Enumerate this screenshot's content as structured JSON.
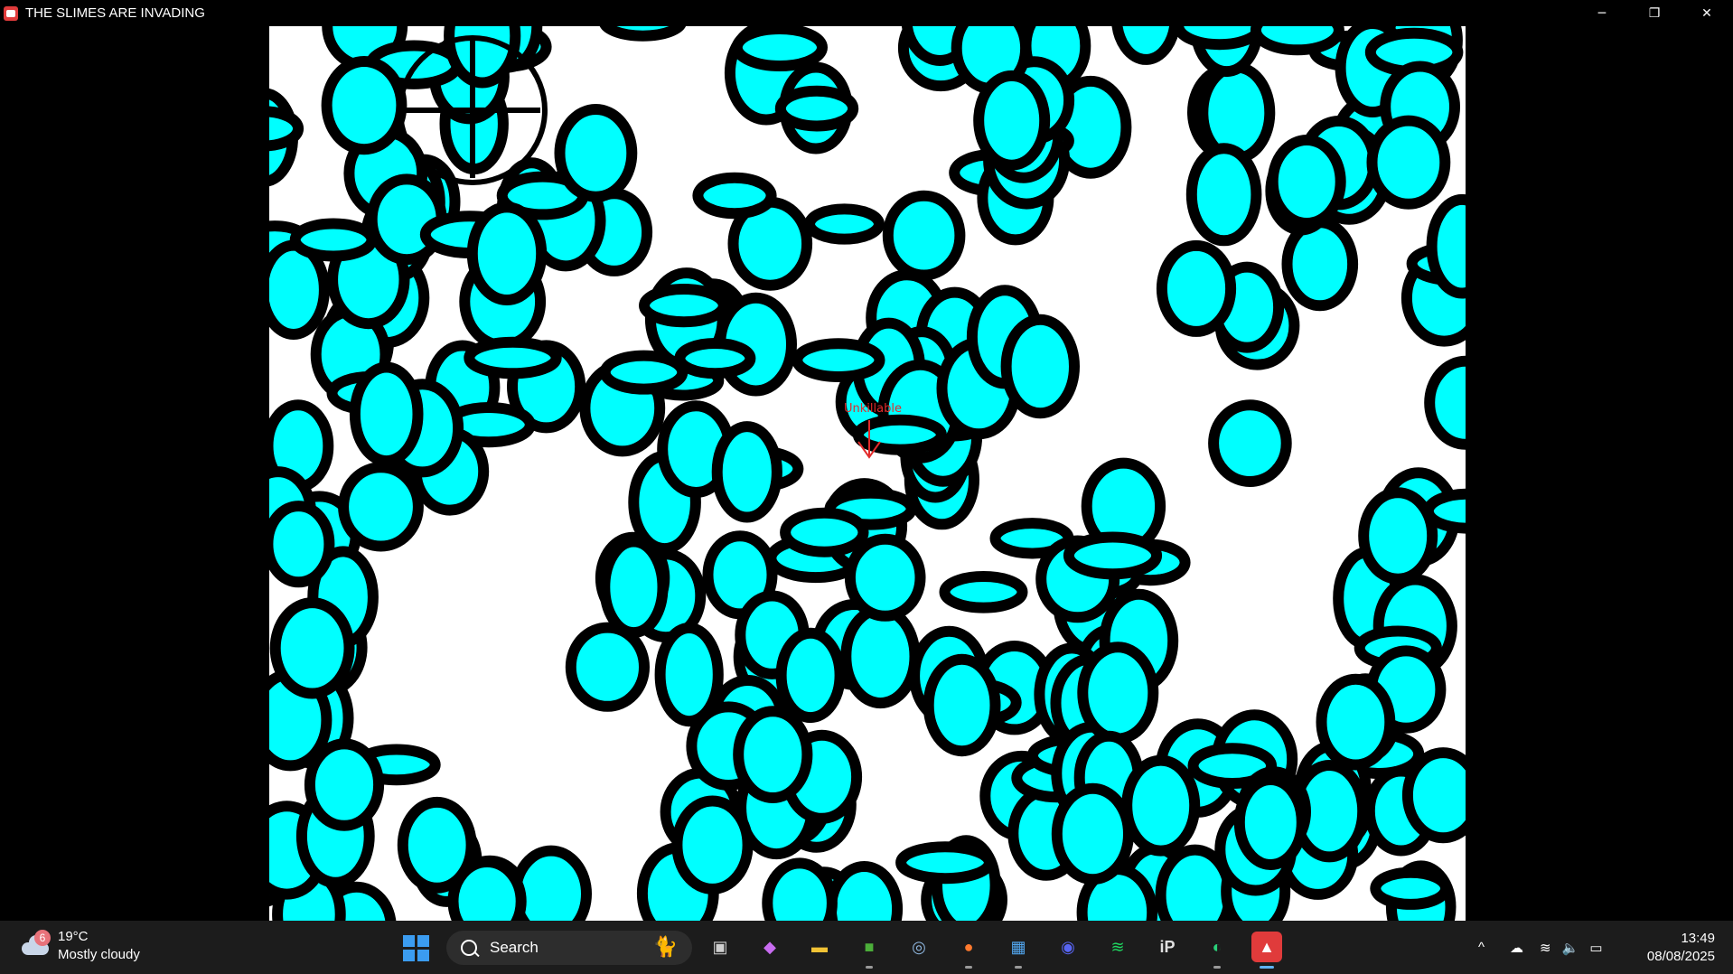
{
  "window": {
    "title": "THE SLIMES ARE INVADING",
    "app_icon": "game-app-icon",
    "controls": {
      "minimize": "─",
      "maximize": "❐",
      "close": "✕"
    }
  },
  "game": {
    "background_color": "#ffffff",
    "slime_color": "#00ffff",
    "outline_color": "#000000",
    "marker": {
      "label": "Unkillable",
      "color": "#e22b2b"
    },
    "crosshair": {
      "icon": "crosshair-icon"
    }
  },
  "taskbar": {
    "weather": {
      "badge": "6",
      "temperature": "19°C",
      "condition": "Mostly cloudy"
    },
    "search": {
      "label": "Search"
    },
    "apps": [
      {
        "name": "task-view",
        "glyph": "▣"
      },
      {
        "name": "copilot",
        "glyph": "◆"
      },
      {
        "name": "file-explorer",
        "glyph": "▬"
      },
      {
        "name": "minecraft",
        "glyph": "■"
      },
      {
        "name": "steam",
        "glyph": "◎"
      },
      {
        "name": "firefox",
        "glyph": "●"
      },
      {
        "name": "microsoft-store",
        "glyph": "▦"
      },
      {
        "name": "discord",
        "glyph": "◉"
      },
      {
        "name": "spotify",
        "glyph": "≋"
      },
      {
        "name": "ip-app",
        "glyph": "iP"
      },
      {
        "name": "game-launcher",
        "glyph": "◐"
      },
      {
        "name": "slimes-game",
        "glyph": "▲"
      }
    ],
    "tray": {
      "chevron": "^",
      "wifi": "wifi-icon",
      "volume": "volume-icon",
      "battery": "battery-icon"
    },
    "clock": {
      "time": "13:49",
      "date": "08/08/2025"
    }
  }
}
